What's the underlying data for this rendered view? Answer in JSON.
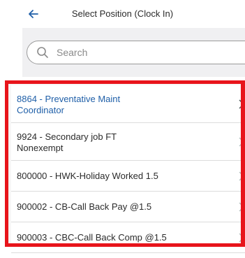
{
  "header": {
    "title": "Select Position (Clock In)",
    "back_icon": "back-arrow-icon"
  },
  "search": {
    "placeholder": "Search",
    "value": "",
    "icon": "search-icon"
  },
  "positions": [
    {
      "label": "8864 - Preventative Maint Coordinator",
      "selected": true
    },
    {
      "label": "9924 - Secondary job FT Nonexempt",
      "selected": false
    },
    {
      "label": "800000 - HWK-Holiday Worked 1.5",
      "selected": false
    },
    {
      "label": "900002 - CB-Call Back Pay @1.5",
      "selected": false
    },
    {
      "label": "900003 - CBC-Call Back Comp @1.5",
      "selected": false
    }
  ],
  "colors": {
    "accent": "#1f5fa8",
    "highlight": "#e8141b",
    "text": "#2b2b2b",
    "divider": "#dcdcdc"
  }
}
